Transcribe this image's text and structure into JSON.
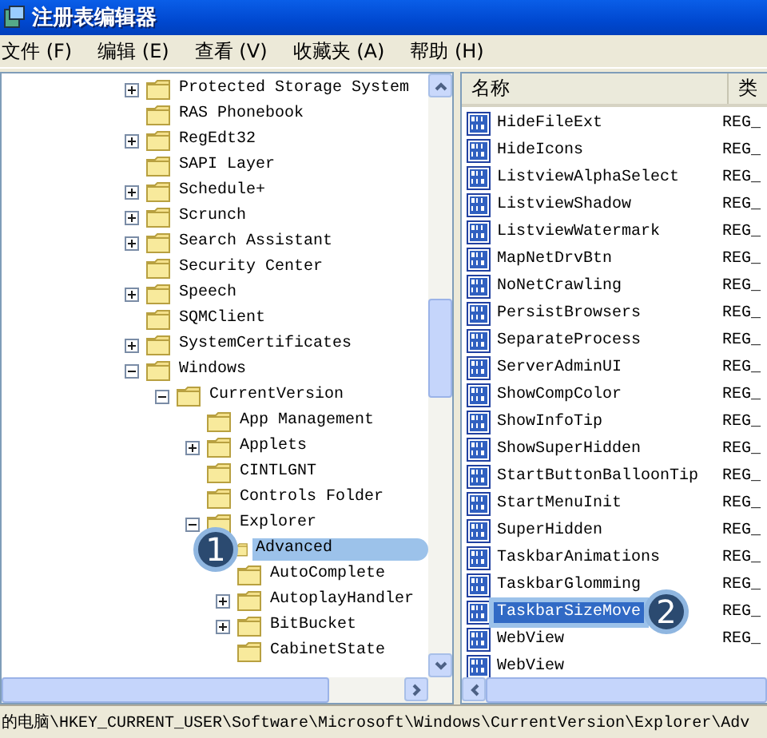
{
  "window": {
    "title": "注册表编辑器"
  },
  "menu": [
    {
      "label": "文件 (F)"
    },
    {
      "label": "编辑 (E)"
    },
    {
      "label": "查看 (V)"
    },
    {
      "label": "收藏夹 (A)"
    },
    {
      "label": "帮助 (H)"
    }
  ],
  "tree": [
    {
      "label": "Protected Storage System",
      "expanded": false,
      "selected": false
    },
    {
      "label": "RAS Phonebook",
      "selected": false
    },
    {
      "label": "RegEdt32",
      "expanded": false,
      "selected": false
    },
    {
      "label": "SAPI Layer",
      "selected": false
    },
    {
      "label": "Schedule+",
      "expanded": false,
      "selected": false
    },
    {
      "label": "Scrunch",
      "expanded": false,
      "selected": false
    },
    {
      "label": "Search Assistant",
      "expanded": false,
      "selected": false
    },
    {
      "label": "Security Center",
      "selected": false
    },
    {
      "label": "Speech",
      "expanded": false,
      "selected": false
    },
    {
      "label": "SQMClient",
      "selected": false
    },
    {
      "label": "SystemCertificates",
      "expanded": false,
      "selected": false
    },
    {
      "label": "Windows",
      "expanded": true,
      "selected": false,
      "children": [
        {
          "label": "CurrentVersion",
          "expanded": true,
          "selected": false,
          "children": [
            {
              "label": "App Management",
              "selected": false
            },
            {
              "label": "Applets",
              "expanded": false,
              "selected": false
            },
            {
              "label": "CINTLGNT",
              "selected": false
            },
            {
              "label": "Controls Folder",
              "selected": false
            },
            {
              "label": "Explorer",
              "expanded": true,
              "selected": false,
              "children": [
                {
                  "label": "Advanced",
                  "selected": true,
                  "callout": "1"
                },
                {
                  "label": "AutoComplete",
                  "selected": false
                },
                {
                  "label": "AutoplayHandler",
                  "expanded": false,
                  "selected": false
                },
                {
                  "label": "BitBucket",
                  "expanded": false,
                  "selected": false
                },
                {
                  "label": "CabinetState",
                  "selected": false
                }
              ]
            }
          ]
        }
      ]
    }
  ],
  "list": {
    "columns": [
      "名称",
      "类"
    ],
    "rows": [
      {
        "name": "HideFileExt",
        "type": "REG_",
        "selected": false
      },
      {
        "name": "HideIcons",
        "type": "REG_",
        "selected": false
      },
      {
        "name": "ListviewAlphaSelect",
        "type": "REG_",
        "selected": false
      },
      {
        "name": "ListviewShadow",
        "type": "REG_",
        "selected": false
      },
      {
        "name": "ListviewWatermark",
        "type": "REG_",
        "selected": false
      },
      {
        "name": "MapNetDrvBtn",
        "type": "REG_",
        "selected": false
      },
      {
        "name": "NoNetCrawling",
        "type": "REG_",
        "selected": false
      },
      {
        "name": "PersistBrowsers",
        "type": "REG_",
        "selected": false
      },
      {
        "name": "SeparateProcess",
        "type": "REG_",
        "selected": false
      },
      {
        "name": "ServerAdminUI",
        "type": "REG_",
        "selected": false
      },
      {
        "name": "ShowCompColor",
        "type": "REG_",
        "selected": false
      },
      {
        "name": "ShowInfoTip",
        "type": "REG_",
        "selected": false
      },
      {
        "name": "ShowSuperHidden",
        "type": "REG_",
        "selected": false
      },
      {
        "name": "StartButtonBalloonTip",
        "type": "REG_",
        "selected": false
      },
      {
        "name": "StartMenuInit",
        "type": "REG_",
        "selected": false
      },
      {
        "name": "SuperHidden",
        "type": "REG_",
        "selected": false
      },
      {
        "name": "TaskbarAnimations",
        "type": "REG_",
        "selected": false
      },
      {
        "name": "TaskbarGlomming",
        "type": "REG_",
        "selected": false
      },
      {
        "name": "TaskbarSizeMove",
        "type": "REG_",
        "selected": true,
        "callout": "2"
      },
      {
        "name": "WebView",
        "type": "REG_",
        "selected": false
      },
      {
        "name": "WebView",
        "selected": false
      }
    ]
  },
  "status_bar": "的电脑\\HKEY_CURRENT_USER\\Software\\Microsoft\\Windows\\CurrentVersion\\Explorer\\Adv"
}
